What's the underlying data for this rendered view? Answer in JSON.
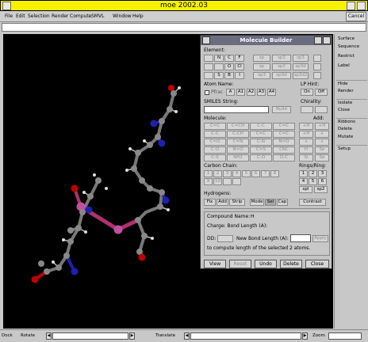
{
  "window": {
    "title": "moe 2002.03"
  },
  "menubar": {
    "items": [
      "File",
      "Edit",
      "Selection",
      "Render",
      "Compute",
      "SMVL",
      "Window",
      "Help"
    ],
    "cancel_label": "Cancel"
  },
  "right_panel": {
    "items": [
      "Surface",
      "Sequence",
      "Restrict",
      "Label",
      "Hide",
      "Render",
      "Isolate",
      "Close",
      "Ribbons",
      "Delete",
      "Mutate",
      "Setup"
    ]
  },
  "statusbar": {
    "items": [
      "Dock",
      "Rotate",
      "Translate",
      "Zoom"
    ]
  },
  "dialog": {
    "title": "Molecule Builder",
    "element_label": "Element:",
    "elements": [
      [
        "",
        "N",
        "C",
        "F"
      ],
      [
        "",
        "",
        "O",
        "Cl"
      ],
      [
        "",
        "S",
        "B",
        "I"
      ]
    ],
    "hybrid_buttons": [
      [
        "sp",
        "sp2",
        "sp3"
      ],
      [
        "sp",
        "sp2",
        "sp3d"
      ],
      [
        "sp3",
        "sp3d",
        "sp3d2"
      ]
    ],
    "geom_buttons": [
      "",
      "",
      ""
    ],
    "atom_name_label": "Atom Name:",
    "lp_hint_label": "LP Hint:",
    "lp_buttons": [
      "On",
      "Off"
    ],
    "pfrac_label": "Pfrac",
    "atom_name_buttons": [
      "A",
      "A1",
      "A2",
      "A3",
      "A4"
    ],
    "smiles_label": "SMILES String:",
    "smiles_btn": "Build",
    "chirality_label": "Chirality:",
    "molecule_label": "Molecule:",
    "add_label": "Add:",
    "molecule_grid": [
      [
        "C=C",
        "C=CH",
        "C-C",
        "C=C"
      ],
      [
        "C-C",
        "C-CH",
        "C=C",
        "C=C"
      ],
      [
        "C=O",
        "C=N",
        "C-N",
        "N=O"
      ],
      [
        "C-O",
        "N=O",
        "C=S",
        "CNC"
      ],
      [
        "C-S",
        "NH2",
        "C-O",
        "O-C"
      ]
    ],
    "add_grid": [
      [
        "+H",
        "+H"
      ],
      [
        "+H",
        "+"
      ],
      [
        "+",
        "+"
      ],
      [
        "H",
        "Se"
      ],
      [
        "Si",
        "Se"
      ]
    ],
    "carbon_chain_label": "Carbon Chain:",
    "carbon_chain": [
      "1",
      "2",
      "3",
      "4",
      "5",
      "6",
      "7",
      "8",
      "9",
      "10",
      "",
      ""
    ],
    "rings_label": "Rings/Ring:",
    "ring_buttons": [
      [
        "1",
        "2",
        "3"
      ],
      [
        "4",
        "5",
        "6"
      ],
      [
        "spl",
        "sp2"
      ]
    ],
    "hydrogens_label": "Hydrogens:",
    "hydrogen_buttons": [
      "Fix",
      "Add",
      "Strip",
      "Mode",
      "Sel",
      "Cap",
      "Contrast"
    ],
    "compound_name_label": "Compound Name:",
    "compound_name_value": "H",
    "info_line1": "Charge:   Bond Length (A):",
    "new_bond_label": "New Bond Length (A):",
    "new_bond_value": "",
    "apply_label": "Apply",
    "dist_label": "DD:",
    "info_line3": "to compute length of the selected 2 atoms.",
    "bottom_buttons": [
      "View",
      "Reset",
      "Undo",
      "Delete",
      "Close"
    ]
  }
}
